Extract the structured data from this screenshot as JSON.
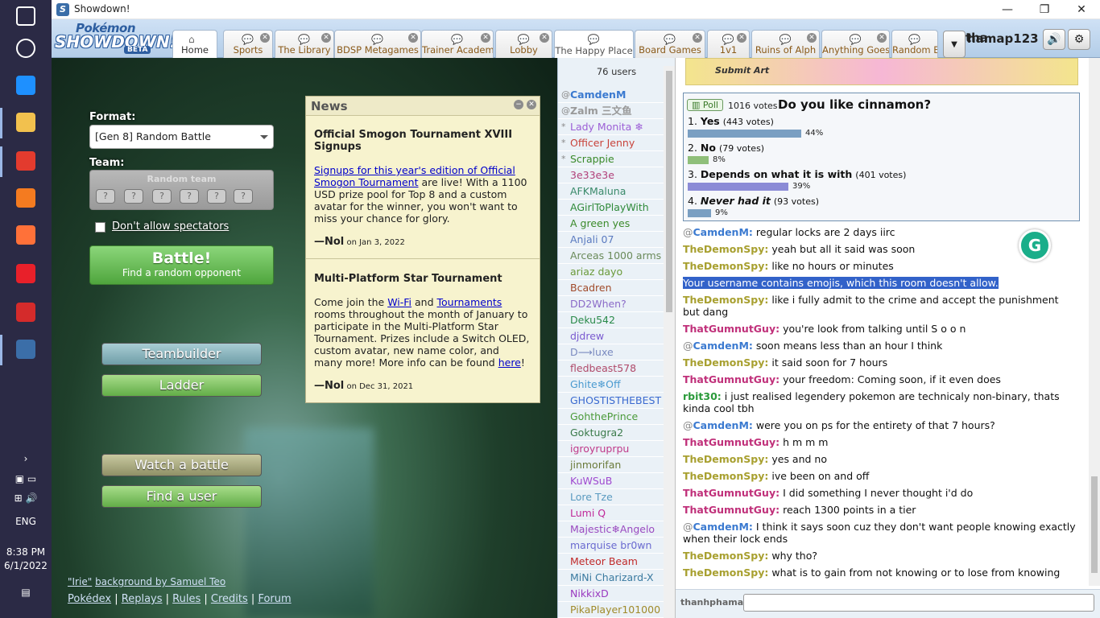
{
  "taskbar": {
    "icons": [
      {
        "name": "windows-start-icon",
        "color": "#ffffff"
      },
      {
        "name": "cortana-search-icon",
        "color": "#ffffff"
      },
      {
        "name": "defender-shield-icon",
        "color": "#1e90ff"
      },
      {
        "name": "file-explorer-icon",
        "color": "#f2c14e"
      },
      {
        "name": "chrome-icon",
        "color": "#e33b2e"
      },
      {
        "name": "podcast-app-icon",
        "color": "#f47b20"
      },
      {
        "name": "firefox-icon",
        "color": "#ff7139"
      },
      {
        "name": "camera-app-icon",
        "color": "#e8202a"
      },
      {
        "name": "speedometer-app-icon",
        "color": "#d42b2b"
      },
      {
        "name": "showdown-app-icon",
        "color": "#3b6ea8"
      }
    ],
    "tray_lang": "ENG",
    "time": "8:38 PM",
    "date": "6/1/2022"
  },
  "window": {
    "title": "Showdown!",
    "minimize": "—",
    "maximize": "❐",
    "close": "✕"
  },
  "header": {
    "logo_top": "Pokémon",
    "logo_main": "SHOWDOWN!",
    "logo_badge": "BETA",
    "tabs": [
      {
        "label": "Home",
        "closable": false
      },
      {
        "label": "Sports",
        "closable": true
      },
      {
        "label": "The Library",
        "closable": true
      },
      {
        "label": "BDSP Metagames",
        "closable": true
      },
      {
        "label": "Trainer Academy",
        "closable": true
      },
      {
        "label": "Lobby",
        "closable": true
      },
      {
        "label": "The Happy Place",
        "closable": false
      },
      {
        "label": "Board Games",
        "closable": true
      },
      {
        "label": "1v1",
        "closable": true
      },
      {
        "label": "Ruins of Alph",
        "closable": true
      },
      {
        "label": "Anything Goes",
        "closable": true
      },
      {
        "label": "Random B",
        "closable": false
      }
    ],
    "username": "thanhphamap123",
    "username_partial_left": "tha",
    "username_partial_right": "hamap123",
    "overflow_icon": "▼",
    "sound_icon": "🔊",
    "settings_icon": "⚙"
  },
  "main": {
    "format_label": "Format:",
    "format_value": "[Gen 8] Random Battle",
    "team_label": "Team:",
    "team_value": "Random team",
    "spectators_label": "Don't allow spectators",
    "battle_label": "Battle!",
    "battle_sub": "Find a random opponent",
    "teambuilder": "Teambuilder",
    "ladder": "Ladder",
    "watch": "Watch a battle",
    "find_user": "Find a user",
    "credits_bg": "\"Irie\"",
    "credits_text": "background by Samuel Teo",
    "footer_links": [
      "Pokédex",
      "Replays",
      "Rules",
      "Credits",
      "Forum"
    ]
  },
  "news": {
    "title": "News",
    "items": [
      {
        "headline": "Official Smogon Tournament XVIII Signups",
        "link": "Signups for this year's edition of Official Smogon Tournament",
        "body": " are live! With a 1100 USD prize pool for Top 8 and a custom avatar for the winner, you won't want to miss your chance for glory.",
        "author": "—Nol",
        "date": "on Jan 3, 2022"
      },
      {
        "headline": "Multi-Platform Star Tournament",
        "pre": "Come join the ",
        "link1": "Wi-Fi",
        "mid": " and ",
        "link2": "Tournaments",
        "body": " rooms throughout the month of January to participate in the Multi-Platform Star Tournament. Prizes include a Switch OLED, custom avatar, new name color, and many more! More info can be found ",
        "link3": "here",
        "end": "!",
        "author": "—Nol",
        "date": "on Dec 31, 2021"
      }
    ]
  },
  "userlist": {
    "count": "76 users",
    "users": [
      {
        "sym": "@",
        "name": "CamdenM",
        "color": "#3b7ad0",
        "bold": true
      },
      {
        "sym": "@",
        "name": "Zalm 三文鱼",
        "color": "#999999",
        "bold": true
      },
      {
        "sym": "*",
        "name": "Lady Monita ❄",
        "color": "#9c5fd6",
        "bold": false
      },
      {
        "sym": "*",
        "name": "Officer Jenny",
        "color": "#c8433b",
        "bold": false
      },
      {
        "sym": "*",
        "name": "Scrappie",
        "color": "#3a8a2a",
        "bold": false
      },
      {
        "sym": "",
        "name": "3e33e3e",
        "color": "#b1407a",
        "bold": false
      },
      {
        "sym": "",
        "name": "AFKMaluna",
        "color": "#3a8a6a",
        "bold": false
      },
      {
        "sym": "",
        "name": "AGirlToPlayWith",
        "color": "#2f8a3a",
        "bold": false
      },
      {
        "sym": "",
        "name": "A green yes",
        "color": "#3a8a2a",
        "bold": false
      },
      {
        "sym": "",
        "name": "Anjali 07",
        "color": "#5a7ac0",
        "bold": false
      },
      {
        "sym": "",
        "name": "Arceas 1000 arms",
        "color": "#6a8a5a",
        "bold": false
      },
      {
        "sym": "",
        "name": "ariaz dayo",
        "color": "#6a9a3a",
        "bold": false
      },
      {
        "sym": "",
        "name": "Bcadren",
        "color": "#a04a2a",
        "bold": false
      },
      {
        "sym": "",
        "name": "DD2When?",
        "color": "#8a6ac8",
        "bold": false
      },
      {
        "sym": "",
        "name": "Deku542",
        "color": "#2a8a4a",
        "bold": false
      },
      {
        "sym": "",
        "name": "djdrew",
        "color": "#7a5ad0",
        "bold": false
      },
      {
        "sym": "",
        "name": "D⟶luxe",
        "color": "#7a8ac0",
        "bold": false
      },
      {
        "sym": "",
        "name": "fledbeast578",
        "color": "#b04a6a",
        "bold": false
      },
      {
        "sym": "",
        "name": "Ghite❄Off",
        "color": "#4a9ad0",
        "bold": false
      },
      {
        "sym": "",
        "name": "GHOSTISTHEBEST",
        "color": "#3a6ad0",
        "bold": false
      },
      {
        "sym": "",
        "name": "GohthePrince",
        "color": "#4a9a3a",
        "bold": false
      },
      {
        "sym": "",
        "name": "Goktugra2",
        "color": "#3a7a4a",
        "bold": false
      },
      {
        "sym": "",
        "name": "igroyruprpu",
        "color": "#c03a8a",
        "bold": false
      },
      {
        "sym": "",
        "name": "jinmorifan",
        "color": "#6a7a3a",
        "bold": false
      },
      {
        "sym": "",
        "name": "KuWSuB",
        "color": "#a04ad0",
        "bold": false
      },
      {
        "sym": "",
        "name": "Lore Tze",
        "color": "#5a9ac0",
        "bold": false
      },
      {
        "sym": "",
        "name": "Lumi Q",
        "color": "#c02a9a",
        "bold": false
      },
      {
        "sym": "",
        "name": "Majestic❄Angelo",
        "color": "#9a4ac0",
        "bold": false
      },
      {
        "sym": "",
        "name": "marquise br0wn",
        "color": "#6a6ad0",
        "bold": false
      },
      {
        "sym": "",
        "name": "Meteor Beam",
        "color": "#c02a2a",
        "bold": false
      },
      {
        "sym": "",
        "name": "MiNi Charizard-X",
        "color": "#3a7aa0",
        "bold": false
      },
      {
        "sym": "",
        "name": "NikkixD",
        "color": "#9a3ac0",
        "bold": false
      },
      {
        "sym": "",
        "name": "PikaPlayer101000",
        "color": "#a08a2a",
        "bold": false
      }
    ]
  },
  "chat": {
    "banner_text": "Submit Art",
    "poll": {
      "tag": "Poll",
      "total": "1016 votes",
      "question": "Do you like cinnamon?",
      "options": [
        {
          "num": "1.",
          "label": "Yes",
          "votes": "(443 votes)",
          "pct": "44%",
          "fraction": 0.44,
          "italic": false
        },
        {
          "num": "2.",
          "label": "No",
          "votes": "(79 votes)",
          "pct": "8%",
          "fraction": 0.08,
          "italic": false
        },
        {
          "num": "3.",
          "label": "Depends on what it is with",
          "votes": "(401 votes)",
          "pct": "39%",
          "fraction": 0.39,
          "italic": false
        },
        {
          "num": "4.",
          "label": "Never had it",
          "votes": "(93 votes)",
          "pct": "9%",
          "fraction": 0.09,
          "italic": true
        }
      ],
      "bar_colors": [
        "#7a9fc2",
        "#8fbf7a",
        "#8b8bd6",
        "#7a9fc2"
      ]
    },
    "messages": [
      {
        "sym": "@",
        "name": "CamdenM:",
        "color": "#3b7ad0",
        "text": "regular locks are 2 days iirc"
      },
      {
        "sym": "",
        "name": "TheDemonSpy:",
        "color": "#a8a030",
        "text": "yeah but all it said was soon"
      },
      {
        "sym": "",
        "name": "TheDemonSpy:",
        "color": "#a8a030",
        "text": "like no hours or minutes"
      },
      {
        "sym": "",
        "name": "",
        "color": "#ffffff",
        "text": "Your username contains emojis, which this room doesn't allow.",
        "highlight": true
      },
      {
        "sym": "",
        "name": "TheDemonSpy:",
        "color": "#a8a030",
        "text": "like i fully admit to the crime and accept the punishment but dang"
      },
      {
        "sym": "",
        "name": "ThatGumnutGuy:",
        "color": "#c0307a",
        "text": "you're look from talking until S o o n"
      },
      {
        "sym": "@",
        "name": "CamdenM:",
        "color": "#3b7ad0",
        "text": "soon means less than an hour I think"
      },
      {
        "sym": "",
        "name": "TheDemonSpy:",
        "color": "#a8a030",
        "text": "it said soon for 7 hours"
      },
      {
        "sym": "",
        "name": "ThatGumnutGuy:",
        "color": "#c0307a",
        "text": "your freedom: Coming soon, if it even does"
      },
      {
        "sym": "",
        "name": "rbit30:",
        "color": "#2a9a3a",
        "text": "i just realised legendery pokemon are technicaly non-binary, thats kinda cool tbh"
      },
      {
        "sym": "@",
        "name": "CamdenM:",
        "color": "#3b7ad0",
        "text": "were you on ps for the entirety of that 7 hours?"
      },
      {
        "sym": "",
        "name": "ThatGumnutGuy:",
        "color": "#c0307a",
        "text": "h m m m"
      },
      {
        "sym": "",
        "name": "TheDemonSpy:",
        "color": "#a8a030",
        "text": "yes and no"
      },
      {
        "sym": "",
        "name": "TheDemonSpy:",
        "color": "#a8a030",
        "text": "ive been on and off"
      },
      {
        "sym": "",
        "name": "ThatGumnutGuy:",
        "color": "#c0307a",
        "text": "I did something I never thought i'd do"
      },
      {
        "sym": "",
        "name": "ThatGumnutGuy:",
        "color": "#c0307a",
        "text": "reach 1300 points in a tier"
      },
      {
        "sym": "@",
        "name": "CamdenM:",
        "color": "#3b7ad0",
        "text": "I think it says soon cuz they don't want people knowing exactly when their lock ends"
      },
      {
        "sym": "",
        "name": "TheDemonSpy:",
        "color": "#a8a030",
        "text": "why tho?"
      },
      {
        "sym": "",
        "name": "TheDemonSpy:",
        "color": "#a8a030",
        "text": "what is to gain from not knowing or to lose from knowing"
      }
    ],
    "me": "thanhphama",
    "grammarly_icon": "G"
  }
}
